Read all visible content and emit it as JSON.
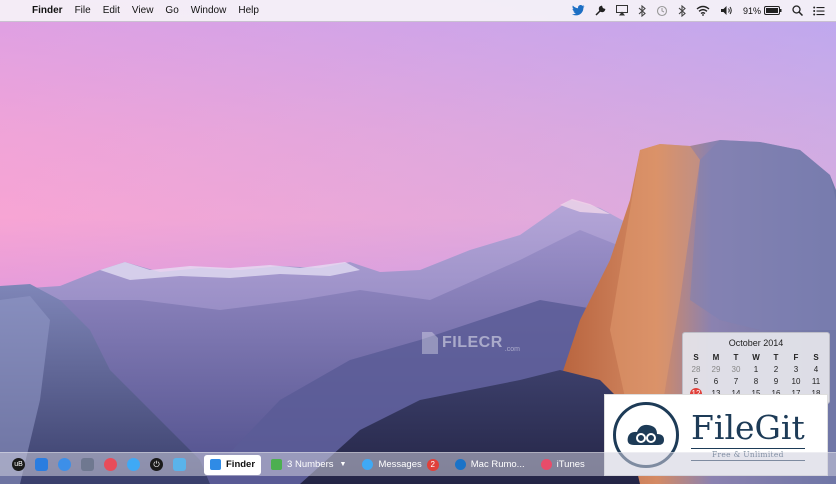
{
  "menubar": {
    "apple": "",
    "app_name": "Finder",
    "items": [
      "File",
      "Edit",
      "View",
      "Go",
      "Window",
      "Help"
    ],
    "status": {
      "battery": "91%",
      "icons": [
        "twitter-icon",
        "tools-icon",
        "airplay-icon",
        "bluetooth-icon",
        "sync-icon",
        "bluetooth-icon",
        "wifi-icon",
        "volume-icon",
        "spotlight-icon",
        "notification-center-icon"
      ]
    }
  },
  "calendar": {
    "title": "October 2014",
    "weekdays": [
      "S",
      "M",
      "T",
      "W",
      "T",
      "F",
      "S"
    ],
    "rows": [
      [
        "28",
        "29",
        "30",
        "1",
        "2",
        "3",
        "4"
      ],
      [
        "5",
        "6",
        "7",
        "8",
        "9",
        "10",
        "11"
      ],
      [
        "12",
        "13",
        "14",
        "15",
        "16",
        "17",
        "18"
      ]
    ],
    "today": "12"
  },
  "watermark": {
    "filecr": "FILECR",
    "filecr_sub": ".com",
    "filegit_title": "FileGit",
    "filegit_sub": "Free & Unlimited"
  },
  "taskbar": {
    "launcher_label": "uB",
    "windows": [
      {
        "label": "Finder",
        "active": true,
        "color": "#2f8be6"
      },
      {
        "label": "3 Numbers",
        "active": false,
        "color": "#4caf50",
        "caret": "▼"
      },
      {
        "label": "Messages",
        "active": false,
        "color": "#3fa9f5",
        "badge": "2"
      },
      {
        "label": "Mac Rumo...",
        "active": false,
        "color": "#1a73c8"
      },
      {
        "label": "iTunes",
        "active": false,
        "color": "#e84c6a"
      }
    ]
  },
  "colors": {
    "accent_red": "#e0403a",
    "brand_navy": "#1d3b57"
  }
}
